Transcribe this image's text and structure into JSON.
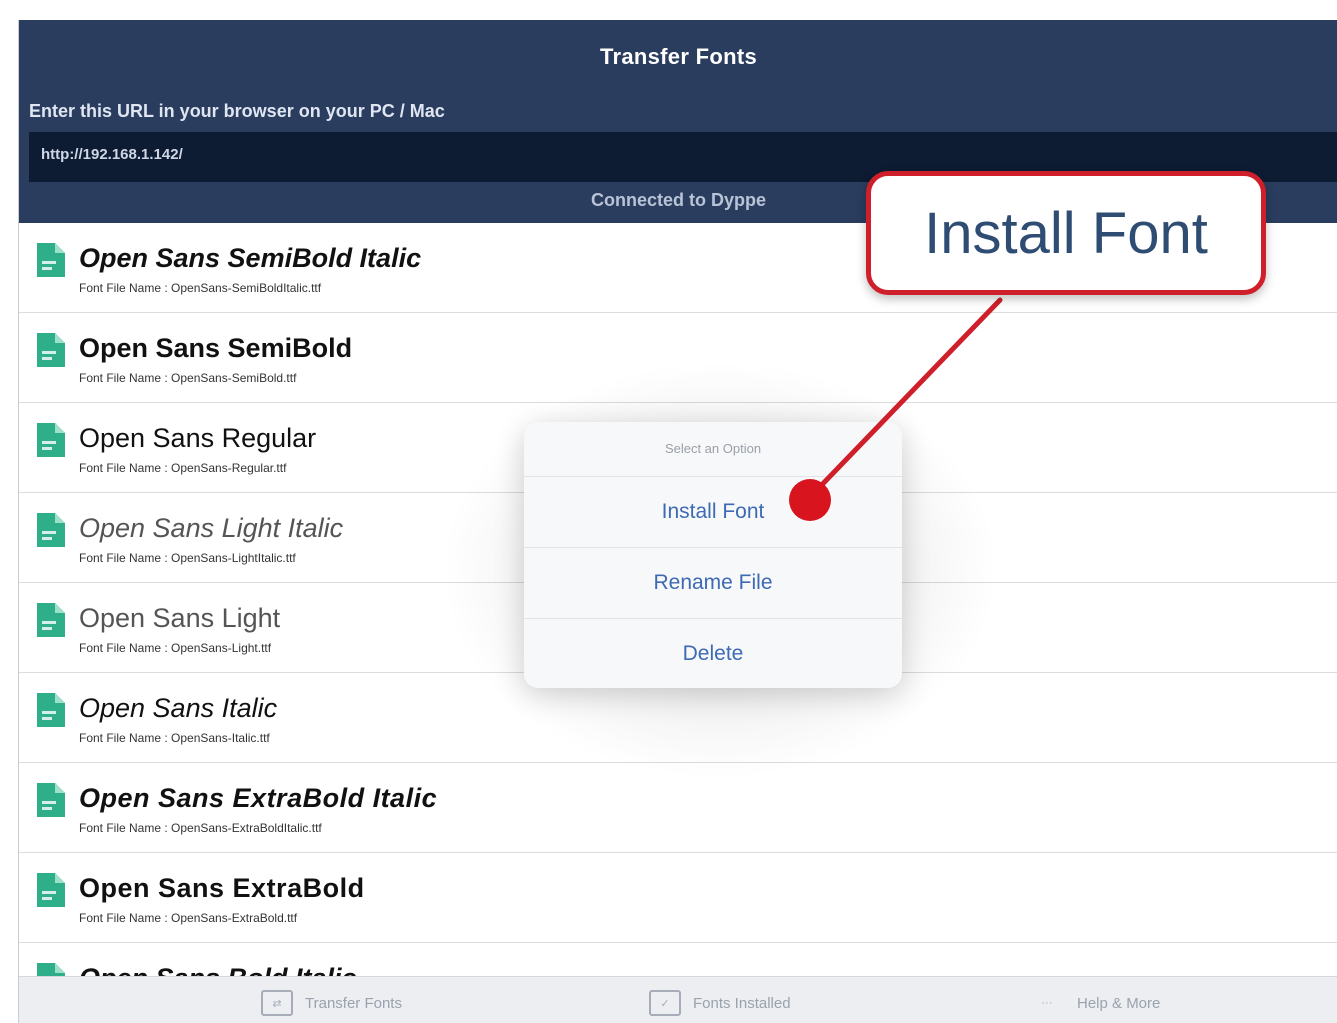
{
  "header": {
    "title": "Transfer Fonts",
    "instruction": "Enter this URL in your browser on your PC / Mac",
    "url": "http://192.168.1.142/",
    "status": "Connected to Dyppe"
  },
  "fonts": [
    {
      "name": "Open Sans SemiBold Italic",
      "file": "Font File Name : OpenSans-SemiBoldItalic.ttf"
    },
    {
      "name": "Open Sans SemiBold",
      "file": "Font File Name : OpenSans-SemiBold.ttf"
    },
    {
      "name": "Open Sans Regular",
      "file": "Font File Name : OpenSans-Regular.ttf"
    },
    {
      "name": "Open Sans Light Italic",
      "file": "Font File Name : OpenSans-LightItalic.ttf"
    },
    {
      "name": "Open Sans Light",
      "file": "Font File Name : OpenSans-Light.ttf"
    },
    {
      "name": "Open Sans Italic",
      "file": "Font File Name : OpenSans-Italic.ttf"
    },
    {
      "name": "Open Sans ExtraBold Italic",
      "file": "Font File Name : OpenSans-ExtraBoldItalic.ttf"
    },
    {
      "name": "Open Sans ExtraBold",
      "file": "Font File Name : OpenSans-ExtraBold.ttf"
    },
    {
      "name": "Open Sans Bold Italic",
      "file": ""
    }
  ],
  "action_sheet": {
    "title": "Select an Option",
    "options": [
      "Install Font",
      "Rename File",
      "Delete"
    ]
  },
  "callout": {
    "label": "Install Font",
    "color": "#cf1f2a"
  },
  "tabs": [
    "Transfer Fonts",
    "Fonts Installed",
    "Help & More"
  ],
  "colors": {
    "header_bg": "#2a3d5e",
    "url_bg": "#0d1b33",
    "file_icon": "#2fae8a",
    "link": "#3d6ab3"
  }
}
